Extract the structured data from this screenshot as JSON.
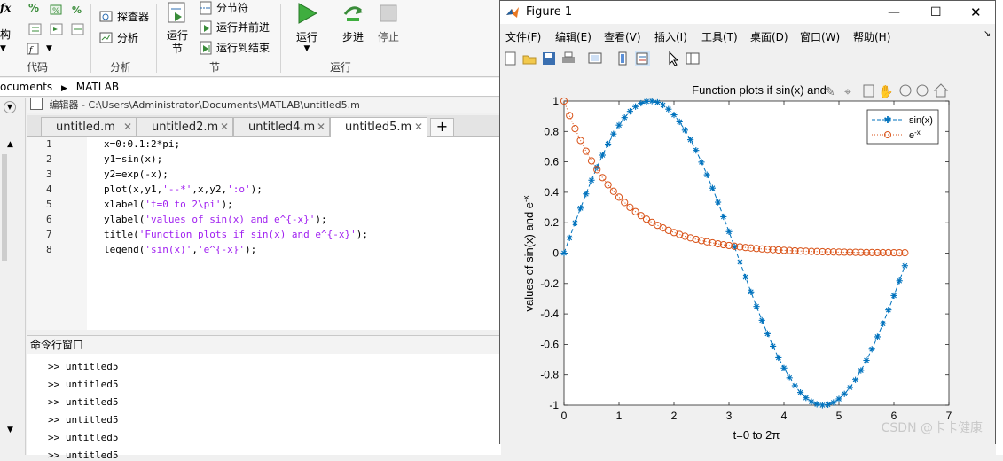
{
  "toolstrip": {
    "left_items": [
      "fx",
      "构",
      "%",
      "代码"
    ],
    "groups": [
      {
        "label": "代码"
      },
      {
        "label": "分析",
        "items": [
          "探查器",
          "分析"
        ]
      },
      {
        "label": "节",
        "big": "运行\n节",
        "items": [
          "分节符",
          "运行并前进",
          "运行到结束"
        ]
      },
      {
        "label": "运行",
        "big_buttons": [
          "运行",
          "步进",
          "停止"
        ]
      }
    ]
  },
  "address": {
    "segments": [
      "ocuments",
      "MATLAB"
    ]
  },
  "editor": {
    "title": "编辑器 - C:\\Users\\Administrator\\Documents\\MATLAB\\untitled5.m",
    "tabs": [
      {
        "label": "untitled.m"
      },
      {
        "label": "untitled2.m"
      },
      {
        "label": "untitled4.m"
      },
      {
        "label": "untitled5.m",
        "active": true
      }
    ],
    "new_tab": "+",
    "lines": [
      {
        "n": "1",
        "parts": [
          {
            "t": "x=0:0.1:2*pi;"
          }
        ]
      },
      {
        "n": "2",
        "parts": [
          {
            "t": "y1=sin(x);"
          }
        ]
      },
      {
        "n": "3",
        "parts": [
          {
            "t": "y2=exp(-x);"
          }
        ]
      },
      {
        "n": "4",
        "parts": [
          {
            "t": "plot(x,y1,"
          },
          {
            "t": "'--*'",
            "s": 1
          },
          {
            "t": ",x,y2,"
          },
          {
            "t": "':o'",
            "s": 1
          },
          {
            "t": ");"
          }
        ]
      },
      {
        "n": "5",
        "parts": [
          {
            "t": "xlabel("
          },
          {
            "t": "'t=0 to 2\\pi'",
            "s": 1
          },
          {
            "t": ");"
          }
        ]
      },
      {
        "n": "6",
        "parts": [
          {
            "t": "ylabel("
          },
          {
            "t": "'values of sin(x) and e^{-x}'",
            "s": 1
          },
          {
            "t": ");"
          }
        ]
      },
      {
        "n": "7",
        "parts": [
          {
            "t": "title("
          },
          {
            "t": "'Function plots if sin(x) and e^{-x}'",
            "s": 1
          },
          {
            "t": ");"
          }
        ]
      },
      {
        "n": "8",
        "parts": [
          {
            "t": "legend("
          },
          {
            "t": "'sin(x)'",
            "s": 1
          },
          {
            "t": ","
          },
          {
            "t": "'e^{-x}'",
            "s": 1
          },
          {
            "t": ");"
          }
        ]
      }
    ]
  },
  "command_window": {
    "title": "命令行窗口",
    "lines": [
      ">> untitled5",
      ">> untitled5",
      ">> untitled5",
      ">> untitled5",
      ">> untitled5",
      ">> untitled5"
    ]
  },
  "figure": {
    "window_title": "Figure 1",
    "menus": [
      "文件(F)",
      "编辑(E)",
      "查看(V)",
      "插入(I)",
      "工具(T)",
      "桌面(D)",
      "窗口(W)",
      "帮助(H)"
    ],
    "watermark": "CSDN @卡卡健康"
  },
  "chart_data": {
    "type": "line",
    "title": "Function plots if sin(x) and e^{-x}",
    "title_visible": "Function plots if sin(x) and",
    "xlabel": "t=0 to 2π",
    "ylabel": "values of sin(x) and e^{-x}",
    "xlim": [
      0,
      7
    ],
    "ylim": [
      -1,
      1
    ],
    "xticks": [
      "0",
      "1",
      "2",
      "3",
      "4",
      "5",
      "6",
      "7"
    ],
    "yticks": [
      "-1",
      "-0.8",
      "-0.6",
      "-0.4",
      "-0.2",
      "0",
      "0.2",
      "0.4",
      "0.6",
      "0.8",
      "1"
    ],
    "legend_position": "top-right",
    "x": [
      0,
      0.1,
      0.2,
      0.3,
      0.4,
      0.5,
      0.6,
      0.7,
      0.8,
      0.9,
      1.0,
      1.1,
      1.2,
      1.3,
      1.4,
      1.5,
      1.6,
      1.7,
      1.8,
      1.9,
      2.0,
      2.1,
      2.2,
      2.3,
      2.4,
      2.5,
      2.6,
      2.7,
      2.8,
      2.9,
      3.0,
      3.1,
      3.2,
      3.3,
      3.4,
      3.5,
      3.6,
      3.7,
      3.8,
      3.9,
      4.0,
      4.1,
      4.2,
      4.3,
      4.4,
      4.5,
      4.6,
      4.7,
      4.8,
      4.9,
      5.0,
      5.1,
      5.2,
      5.3,
      5.4,
      5.5,
      5.6,
      5.7,
      5.8,
      5.9,
      6.0,
      6.1,
      6.2
    ],
    "series": [
      {
        "name": "sin(x)",
        "style": "--*",
        "color": "#0072bd",
        "values": [
          0,
          0.0998,
          0.1987,
          0.2955,
          0.3894,
          0.4794,
          0.5646,
          0.6442,
          0.7174,
          0.7833,
          0.8415,
          0.8912,
          0.932,
          0.9636,
          0.9854,
          0.9975,
          0.9996,
          0.9917,
          0.9738,
          0.9463,
          0.9093,
          0.8632,
          0.8085,
          0.7457,
          0.6755,
          0.5985,
          0.5155,
          0.4274,
          0.335,
          0.2392,
          0.1411,
          0.0416,
          -0.0584,
          -0.1577,
          -0.2555,
          -0.3508,
          -0.4425,
          -0.5298,
          -0.6119,
          -0.6878,
          -0.7568,
          -0.8183,
          -0.8716,
          -0.9162,
          -0.9516,
          -0.9775,
          -0.9937,
          -0.9999,
          -0.9962,
          -0.9825,
          -0.9589,
          -0.9258,
          -0.8835,
          -0.8323,
          -0.7728,
          -0.7055,
          -0.6313,
          -0.5507,
          -0.4646,
          -0.3739,
          -0.2794,
          -0.1822,
          -0.0831
        ]
      },
      {
        "name": "e^{-x}",
        "style": ":o",
        "color": "#d95319",
        "values": [
          1,
          0.9048,
          0.8187,
          0.7408,
          0.6703,
          0.6065,
          0.5488,
          0.4966,
          0.4493,
          0.4066,
          0.3679,
          0.3329,
          0.3012,
          0.2725,
          0.2466,
          0.2231,
          0.2019,
          0.1827,
          0.1653,
          0.1496,
          0.1353,
          0.1225,
          0.1108,
          0.1003,
          0.0907,
          0.0821,
          0.0743,
          0.0672,
          0.0608,
          0.055,
          0.0498,
          0.045,
          0.0408,
          0.0369,
          0.0334,
          0.0302,
          0.0273,
          0.0247,
          0.0224,
          0.0202,
          0.0183,
          0.0166,
          0.015,
          0.0136,
          0.0123,
          0.0111,
          0.0101,
          0.0091,
          0.0082,
          0.0074,
          0.0067,
          0.0061,
          0.0055,
          0.005,
          0.0045,
          0.0041,
          0.0037,
          0.0033,
          0.003,
          0.0027,
          0.0025,
          0.0022,
          0.002
        ]
      }
    ]
  }
}
